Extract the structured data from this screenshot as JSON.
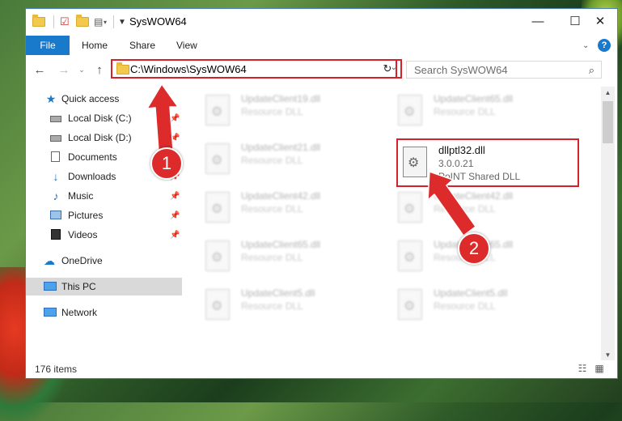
{
  "window": {
    "title": "SysWOW64"
  },
  "tabs": {
    "file": "File",
    "home": "Home",
    "share": "Share",
    "view": "View"
  },
  "address": {
    "path": "C:\\Windows\\SysWOW64"
  },
  "search": {
    "placeholder": "Search SysWOW64"
  },
  "nav": {
    "items": [
      {
        "label": "Quick access"
      },
      {
        "label": "Local Disk (C:)"
      },
      {
        "label": "Local Disk (D:)"
      },
      {
        "label": "Documents"
      },
      {
        "label": "Downloads"
      },
      {
        "label": "Music"
      },
      {
        "label": "Pictures"
      },
      {
        "label": "Videos"
      },
      {
        "label": "OneDrive"
      },
      {
        "label": "This PC"
      },
      {
        "label": "Network"
      }
    ]
  },
  "files": {
    "left": [
      {
        "name": "UpdateClient19.dll",
        "type": "Resource DLL"
      },
      {
        "name": "UpdateClient21.dll",
        "type": "Resource DLL"
      },
      {
        "name": "UpdateClient42.dll",
        "type": "Resource DLL"
      },
      {
        "name": "UpdateClient65.dll",
        "type": "Resource DLL"
      },
      {
        "name": "UpdateClient5.dll",
        "type": "Resource DLL"
      }
    ],
    "right": [
      {
        "name": "UpdateClient65.dll",
        "type": "Resource DLL"
      },
      {
        "name": "UpdateClient42.dll",
        "type": "Resource DLL"
      },
      {
        "name": "UpdateClient65.dll",
        "type": "Resource DLL"
      },
      {
        "name": "UpdateClient5.dll",
        "type": "Resource DLL"
      }
    ],
    "highlighted": {
      "name": "dllptl32.dll",
      "version": "3.0.0.21",
      "description": "PoINT Shared DLL"
    }
  },
  "status": {
    "count": "176 items"
  },
  "badges": {
    "one": "1",
    "two": "2"
  },
  "colors": {
    "accent": "#1979ca",
    "highlight": "#d9202a"
  }
}
